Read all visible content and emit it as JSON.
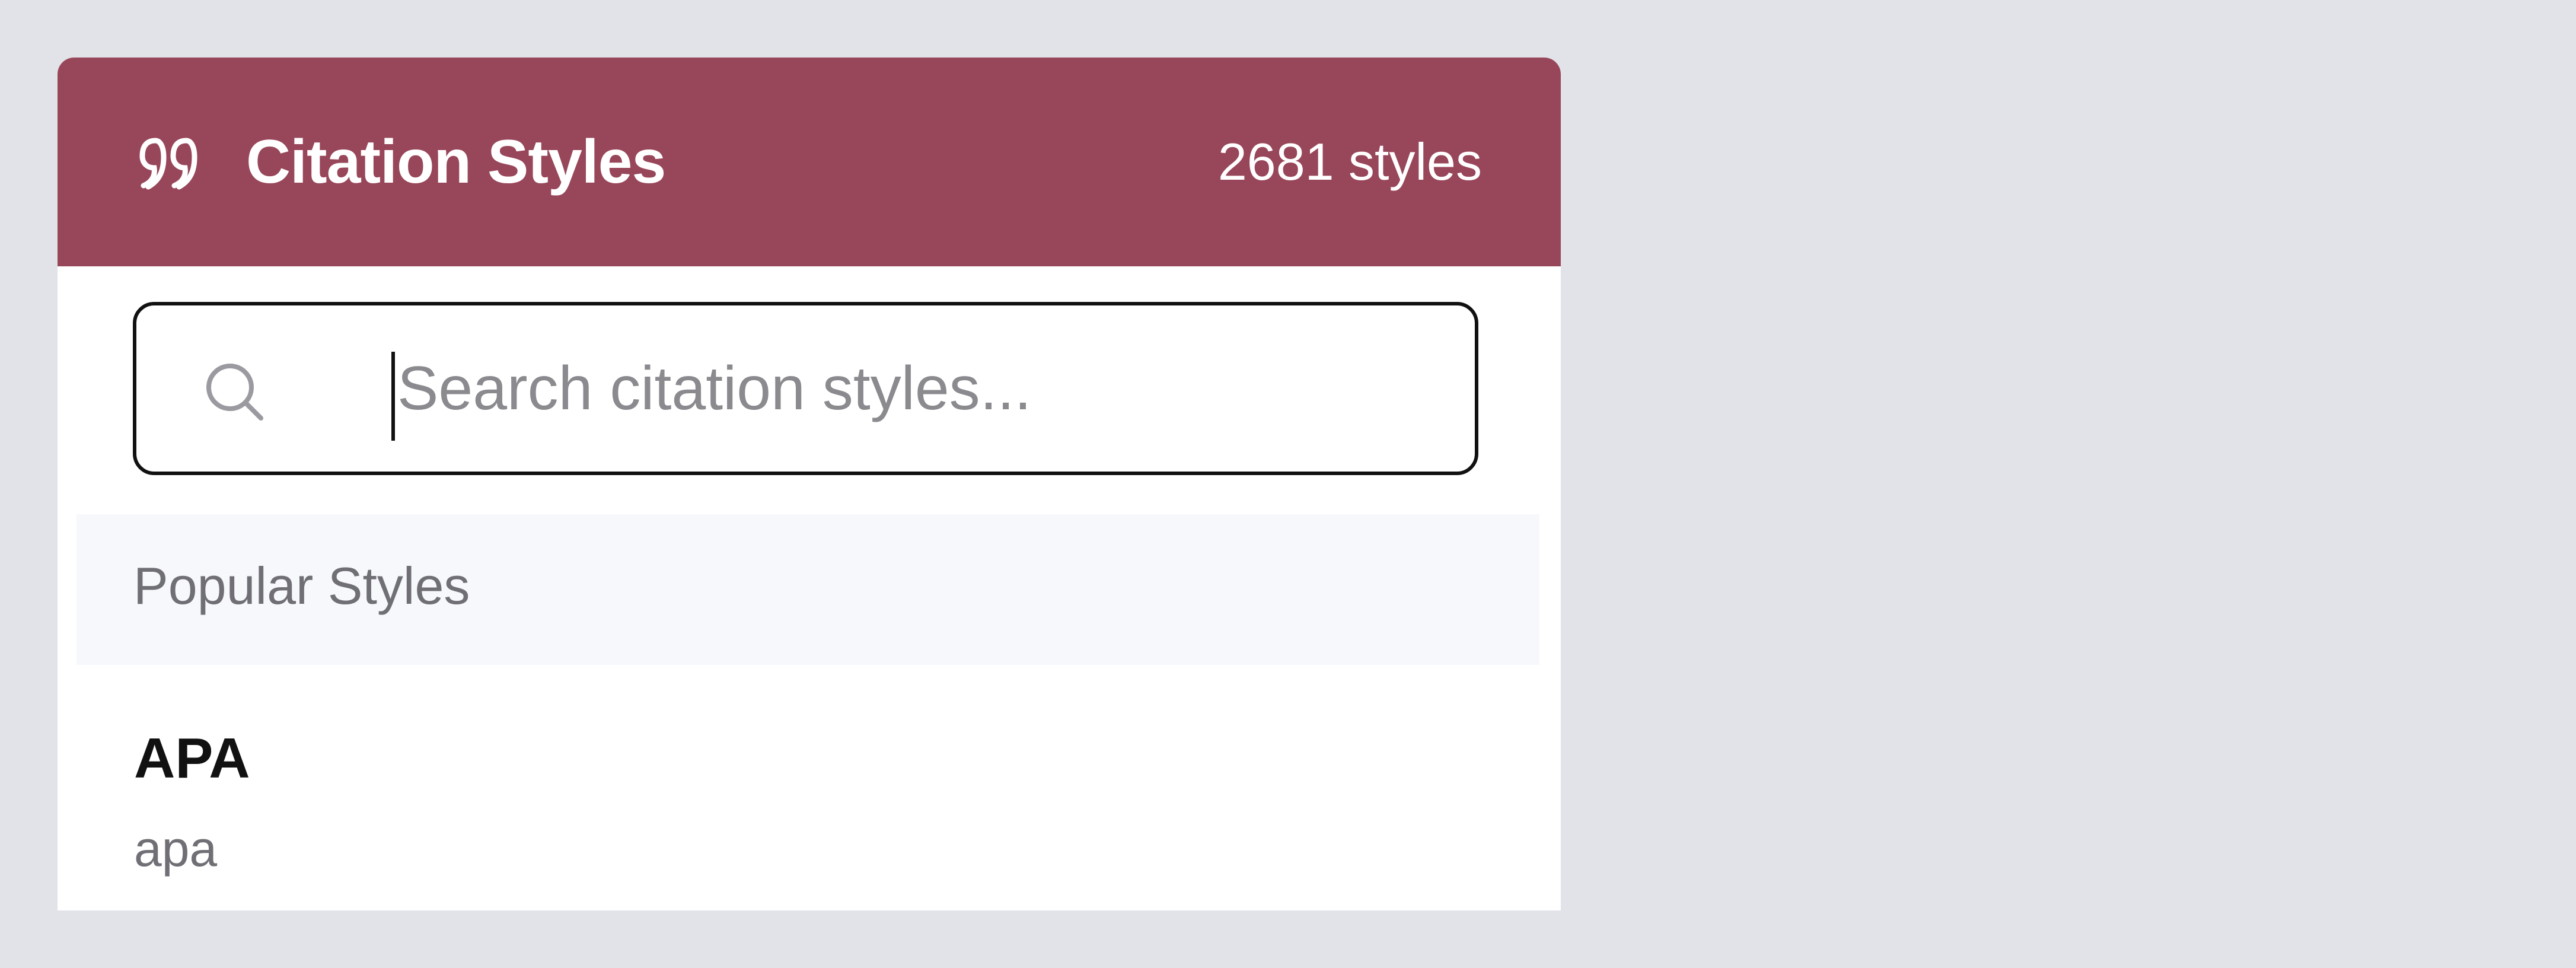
{
  "header": {
    "title": "Citation Styles",
    "count_label": "2681 styles",
    "icon": "quote-icon",
    "color": "#984659"
  },
  "search": {
    "placeholder": "Search citation styles...",
    "value": "",
    "icon": "search-icon"
  },
  "section": {
    "label": "Popular Styles"
  },
  "items": [
    {
      "name": "APA",
      "id": "apa"
    }
  ]
}
